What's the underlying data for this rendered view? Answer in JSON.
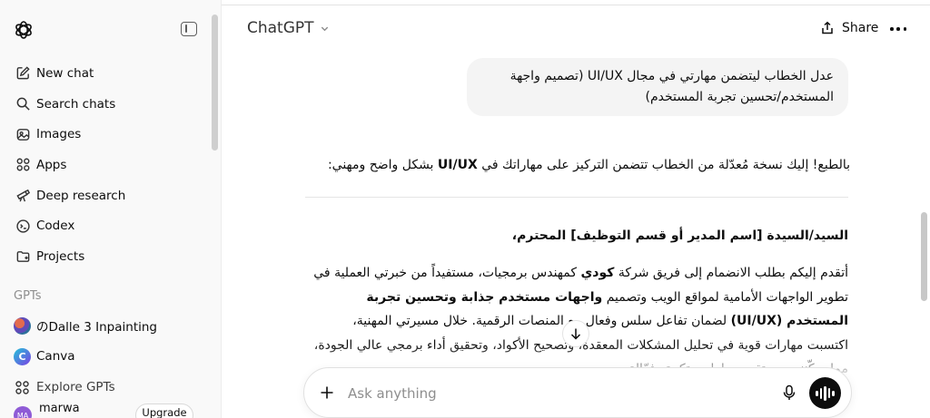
{
  "sidebar": {
    "nav": [
      {
        "label": "New chat",
        "icon": "new-chat-icon"
      },
      {
        "label": "Search chats",
        "icon": "search-icon"
      },
      {
        "label": "Images",
        "icon": "images-icon"
      },
      {
        "label": "Apps",
        "icon": "apps-icon"
      },
      {
        "label": "Deep research",
        "icon": "telescope-icon"
      },
      {
        "label": "Codex",
        "icon": "codex-icon"
      },
      {
        "label": "Projects",
        "icon": "folder-icon"
      }
    ],
    "gpts_label": "GPTs",
    "gpts": [
      {
        "label": "のDalle 3 Inpainting",
        "avatar": "dalle-avatar"
      },
      {
        "label": "Canva",
        "avatar": "canva-avatar",
        "avatar_text": "C"
      },
      {
        "label": "Explore GPTs",
        "avatar": "explore-icon"
      }
    ],
    "user": {
      "name": "marwa",
      "initials": "MA",
      "upgrade_label": "Upgrade"
    }
  },
  "header": {
    "model_label": "ChatGPT",
    "share_label": "Share"
  },
  "conversation": {
    "user_message": "عدل الخطاب ليتضمن مهارتي في مجال UI/UX (تصميم واجهة المستخدم/تحسين تجربة المستخدم)",
    "intro_before": "بالطبع! إليك نسخة مُعدّلة من الخطاب تتضمن التركيز على مهاراتك في ",
    "intro_bold": "UI/UX",
    "intro_after": " بشكل واضح ومهني:",
    "salutation": "السيد/السيدة [اسم المدير أو قسم التوظيف] المحترم،",
    "p1": "أتقدم إليكم بطلب الانضمام إلى فريق شركة ",
    "p1_bold": "كودي",
    "p2": " كمهندس برمجيات، مستفيداً من خبرتي العملية في تطوير الواجهات الأمامية لمواقع الويب وتصميم ",
    "p2_bold": "واجهات مستخدم جذابة وتحسين تجربة المستخدم (UI/UX)",
    "p3": " لضمان تفاعل سلس وفعال مع المنصات الرقمية. خلال مسيرتي المهنية، اكتسبت مهارات قوية في تحليل المشكلات المعقدة، وتصحيح الأكواد، وتحقيق أداء برمجي عالي الجودة، مما يمكّنني من تقديم حلول مبتكرة وفعّالة."
  },
  "composer": {
    "placeholder": "Ask anything"
  },
  "colors": {
    "sidebar_bg": "#f9f9f9",
    "bubble_bg": "#f4f4f4",
    "voice_button": "#0d0d0d"
  }
}
